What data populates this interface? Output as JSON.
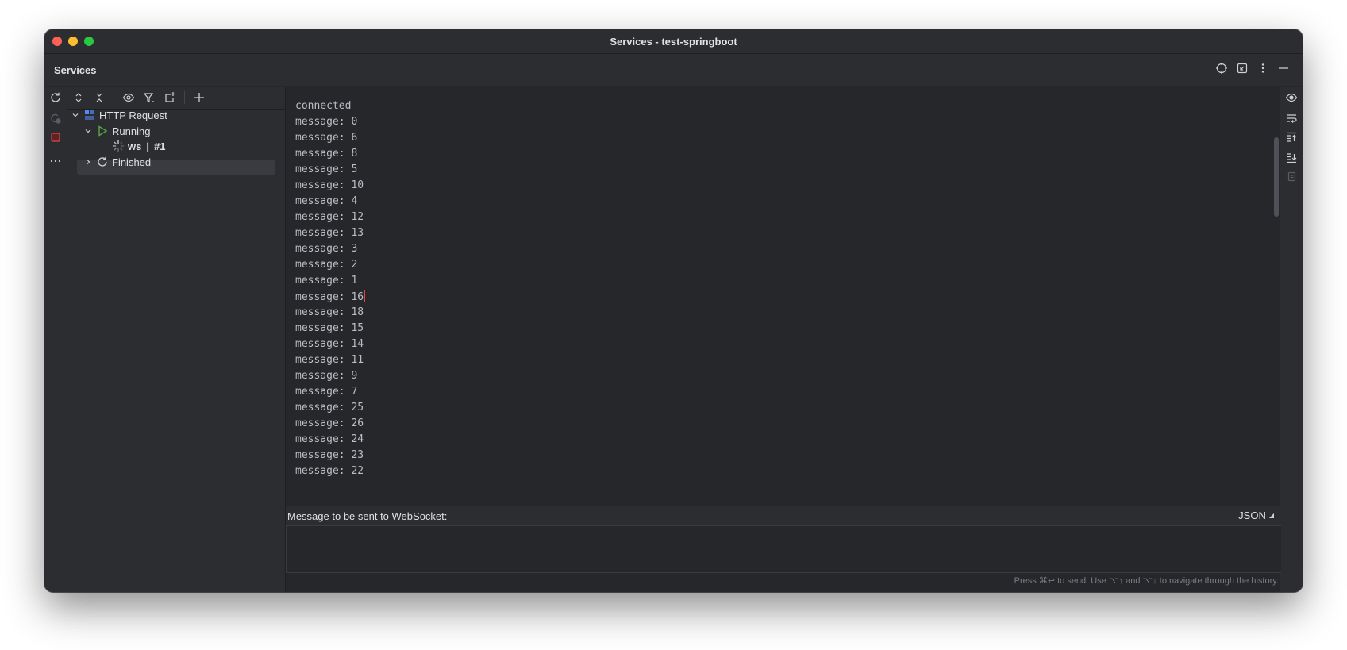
{
  "window": {
    "title": "Services - test-springboot"
  },
  "tool_window": {
    "title": "Services",
    "header_actions": [
      "target-icon",
      "restore-icon",
      "more-vertical-icon",
      "minimize-icon"
    ]
  },
  "left_toolbar_icons": [
    "rerun-icon",
    "rerun-disabled-icon",
    "stop-icon",
    "more-icon"
  ],
  "tree_toolbar_icons": [
    "expand-all-icon",
    "collapse-all-icon",
    "eye-icon",
    "filter-icon",
    "new-group-icon",
    "add-icon"
  ],
  "tree": {
    "root": {
      "label": "HTTP Request",
      "icon": "http-request-icon"
    },
    "running": {
      "label": "Running",
      "icon": "run-icon"
    },
    "ws_item": {
      "name": "ws",
      "separator": "|",
      "number": "#1",
      "icon": "spinner-icon"
    },
    "finished": {
      "label": "Finished",
      "icon": "refresh-icon"
    }
  },
  "console": {
    "lines": [
      "connected",
      "message: 0",
      "message: 6",
      "message: 8",
      "message: 5",
      "message: 10",
      "message: 4",
      "message: 12",
      "message: 13",
      "message: 3",
      "message: 2",
      "message: 1",
      "message: 16",
      "message: 18",
      "message: 15",
      "message: 14",
      "message: 11",
      "message: 9",
      "message: 7",
      "message: 25",
      "message: 26",
      "message: 24",
      "message: 23",
      "message: 22"
    ]
  },
  "right_toolbar_icons": [
    "eye-icon",
    "soft-wrap-icon",
    "scroll-to-top-icon",
    "scroll-to-end-icon",
    "copy-icon"
  ],
  "message_panel": {
    "label": "Message to be sent to WebSocket:",
    "format": "JSON",
    "hint": "Press ⌘↩ to send. Use ⌥↑ and ⌥↓ to navigate through the history."
  },
  "colors": {
    "window_bg": "#25272b",
    "panel_bg": "#2b2d30",
    "text": "#dfe1e5",
    "run_green": "#57a64a",
    "stop_red": "#e34444"
  }
}
